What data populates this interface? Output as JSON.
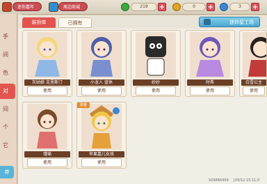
{
  "topbar": {
    "left_pill": "迷你嘉年华>>",
    "center_pill": "周边商城>>",
    "stats": [
      {
        "value": "219",
        "icon": "green-bean-icon",
        "color": "#3fa83f"
      },
      {
        "value": "0",
        "icon": "star-coin-icon",
        "color": "#e2a424"
      },
      {
        "value": "3",
        "icon": "mini-coin-icon",
        "color": "#3d86d6"
      }
    ],
    "plus": "+",
    "close": "✕"
  },
  "sidebar": {
    "items": [
      {
        "label": "手"
      },
      {
        "label": "间"
      },
      {
        "label": "色"
      },
      {
        "label": "对"
      },
      {
        "label": "间"
      },
      {
        "label": "个"
      },
      {
        "label": "它"
      }
    ],
    "bottom_label": "券"
  },
  "tabs": {
    "active": "装扮库",
    "inactive": "已拥有"
  },
  "workshop_label": "迷你星工场",
  "cards": [
    {
      "name": "灰姑娘 克里斯汀",
      "use": "使用",
      "hair": "#f4d77c",
      "outfit": "#8fb8e6",
      "tag": ""
    },
    {
      "name": "小龙人 蓝休",
      "use": "使用",
      "hair": "#4c5fa8",
      "outfit": "#7a8fd0",
      "tag": ""
    },
    {
      "name": "妙妙",
      "use": "使用",
      "hair": "#2a2a2a",
      "outfit": "#ffffff",
      "tag": ""
    },
    {
      "name": "时希",
      "use": "使用",
      "hair": "#6f57b8",
      "outfit": "#b88be0",
      "tag": ""
    },
    {
      "name": "白雪公主",
      "use": "使用",
      "hair": "#2a1f1f",
      "outfit": "#c23b3b",
      "tag": ""
    },
    {
      "name": "瑾瑜",
      "use": "使用",
      "hair": "#7b4a2a",
      "outfit": "#e07070",
      "tag": ""
    },
    {
      "name": "苹果嘉儿女孩",
      "use": "使用",
      "hair": "#f3c64a",
      "outfit": "#e6a03a",
      "tag": "限量"
    }
  ],
  "footer": {
    "uid": "929866499",
    "version": "[09/12 15:11:0"
  }
}
